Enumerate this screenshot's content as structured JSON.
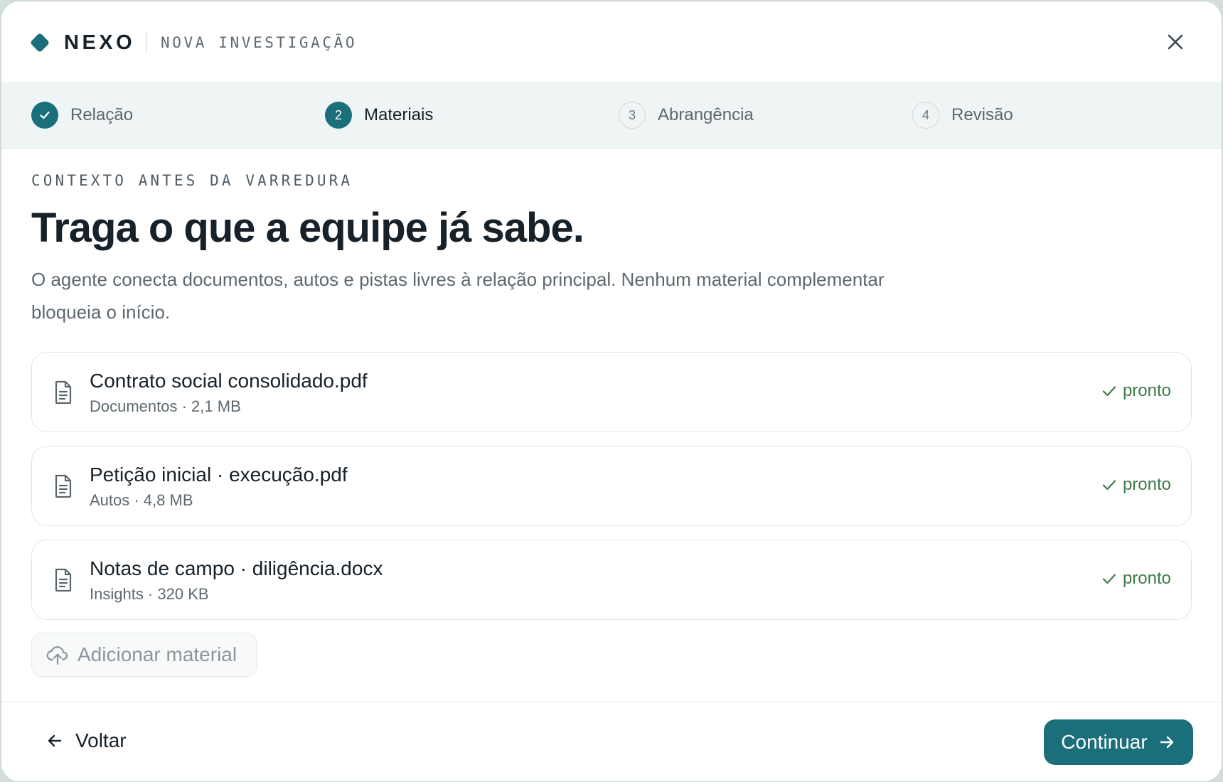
{
  "header": {
    "brand": "NEXO",
    "subtitle": "NOVA INVESTIGAÇÃO",
    "logo_icon": "diamond-logo-icon",
    "close_icon": "close-icon"
  },
  "colors": {
    "accent": "#1b6f7a",
    "stepper_bg": "#eef5f4",
    "success": "#3e7a47",
    "text_primary": "#16212a",
    "text_muted": "#5c6870"
  },
  "stepper": {
    "steps": [
      {
        "number": "",
        "label": "Relação",
        "state": "done",
        "icon": "check-icon"
      },
      {
        "number": "2",
        "label": "Materiais",
        "state": "active"
      },
      {
        "number": "3",
        "label": "Abrangência",
        "state": "pending"
      },
      {
        "number": "4",
        "label": "Revisão",
        "state": "pending"
      }
    ]
  },
  "main": {
    "eyebrow": "CONTEXTO ANTES DA VARREDURA",
    "title": "Traga o que a equipe já sabe.",
    "description": "O agente conecta documentos, autos e pistas livres à relação principal. Nenhum material complementar bloqueia o início.",
    "files": [
      {
        "name": "Contrato social consolidado.pdf",
        "meta": "Documentos · 2,1 MB",
        "status": "pronto",
        "icon": "document-icon"
      },
      {
        "name": "Petição inicial · execução.pdf",
        "meta": "Autos · 4,8 MB",
        "status": "pronto",
        "icon": "document-icon"
      },
      {
        "name": "Notas de campo · diligência.docx",
        "meta": "Insights · 320 KB",
        "status": "pronto",
        "icon": "document-icon"
      }
    ],
    "add_button": {
      "label": "Adicionar material",
      "icon": "cloud-upload-icon"
    }
  },
  "footer": {
    "back_label": "Voltar",
    "back_icon": "arrow-left-icon",
    "continue_label": "Continuar",
    "continue_icon": "arrow-right-icon"
  }
}
